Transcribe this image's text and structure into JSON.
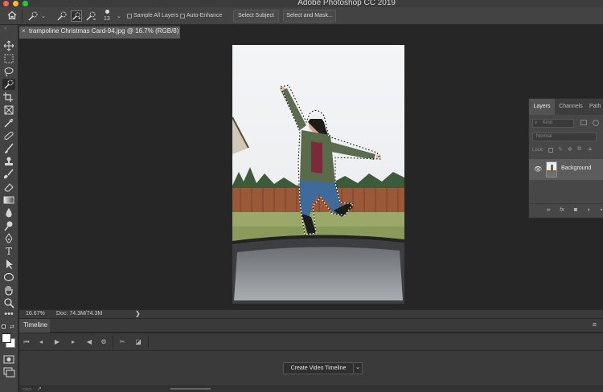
{
  "window": {
    "title": "Adobe Photoshop CC 2019"
  },
  "options_bar": {
    "brush_size": "13",
    "sample_all_layers": "Sample All Layers",
    "auto_enhance": "Auto-Enhance",
    "select_subject": "Select Subject",
    "select_and_mask": "Select and Mask..."
  },
  "document": {
    "tab_label": "trampoline Christmas Card-94.jpg @ 16.7% (RGB/8)",
    "close_glyph": "×"
  },
  "status": {
    "zoom": "16.67%",
    "doc_info": "Doc: 74.3M/74.3M",
    "arrow": "❯"
  },
  "timeline": {
    "tab_label": "Timeline",
    "create_button": "Create Video Timeline",
    "menu_glyph": "≡"
  },
  "layers_panel": {
    "tabs": [
      "Layers",
      "Channels",
      "Path"
    ],
    "kind_placeholder": "Kind",
    "blend_mode": "Normal",
    "lock_label": "Lock:",
    "layer_name": "Background"
  },
  "colors": {
    "accent_traffic_red": "#ff5f57",
    "accent_traffic_yellow": "#febc2e",
    "accent_traffic_green": "#28c840"
  }
}
